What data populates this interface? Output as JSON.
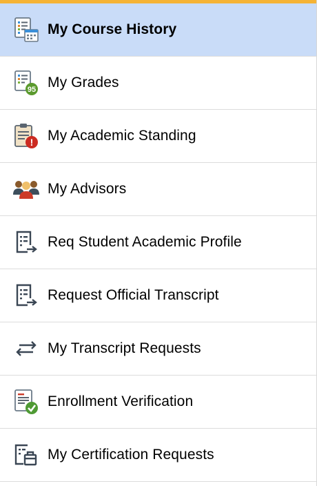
{
  "colors": {
    "accent_bar": "#f5b335",
    "selected_bg": "#c9dcf8",
    "divider": "#dcdcdc"
  },
  "menu": {
    "items": [
      {
        "label": "My Course History",
        "icon": "course-history-icon",
        "selected": true
      },
      {
        "label": "My Grades",
        "icon": "grades-icon",
        "selected": false
      },
      {
        "label": "My Academic Standing",
        "icon": "academic-standing-icon",
        "selected": false
      },
      {
        "label": "My Advisors",
        "icon": "advisors-icon",
        "selected": false
      },
      {
        "label": "Req Student Academic Profile",
        "icon": "request-form-icon",
        "selected": false
      },
      {
        "label": "Request Official Transcript",
        "icon": "request-form-icon",
        "selected": false
      },
      {
        "label": "My Transcript Requests",
        "icon": "exchange-arrows-icon",
        "selected": false
      },
      {
        "label": "Enrollment Verification",
        "icon": "verification-check-icon",
        "selected": false
      },
      {
        "label": "My Certification Requests",
        "icon": "certification-icon",
        "selected": false
      }
    ],
    "grade_badge": "95",
    "alert_mark": "!"
  }
}
